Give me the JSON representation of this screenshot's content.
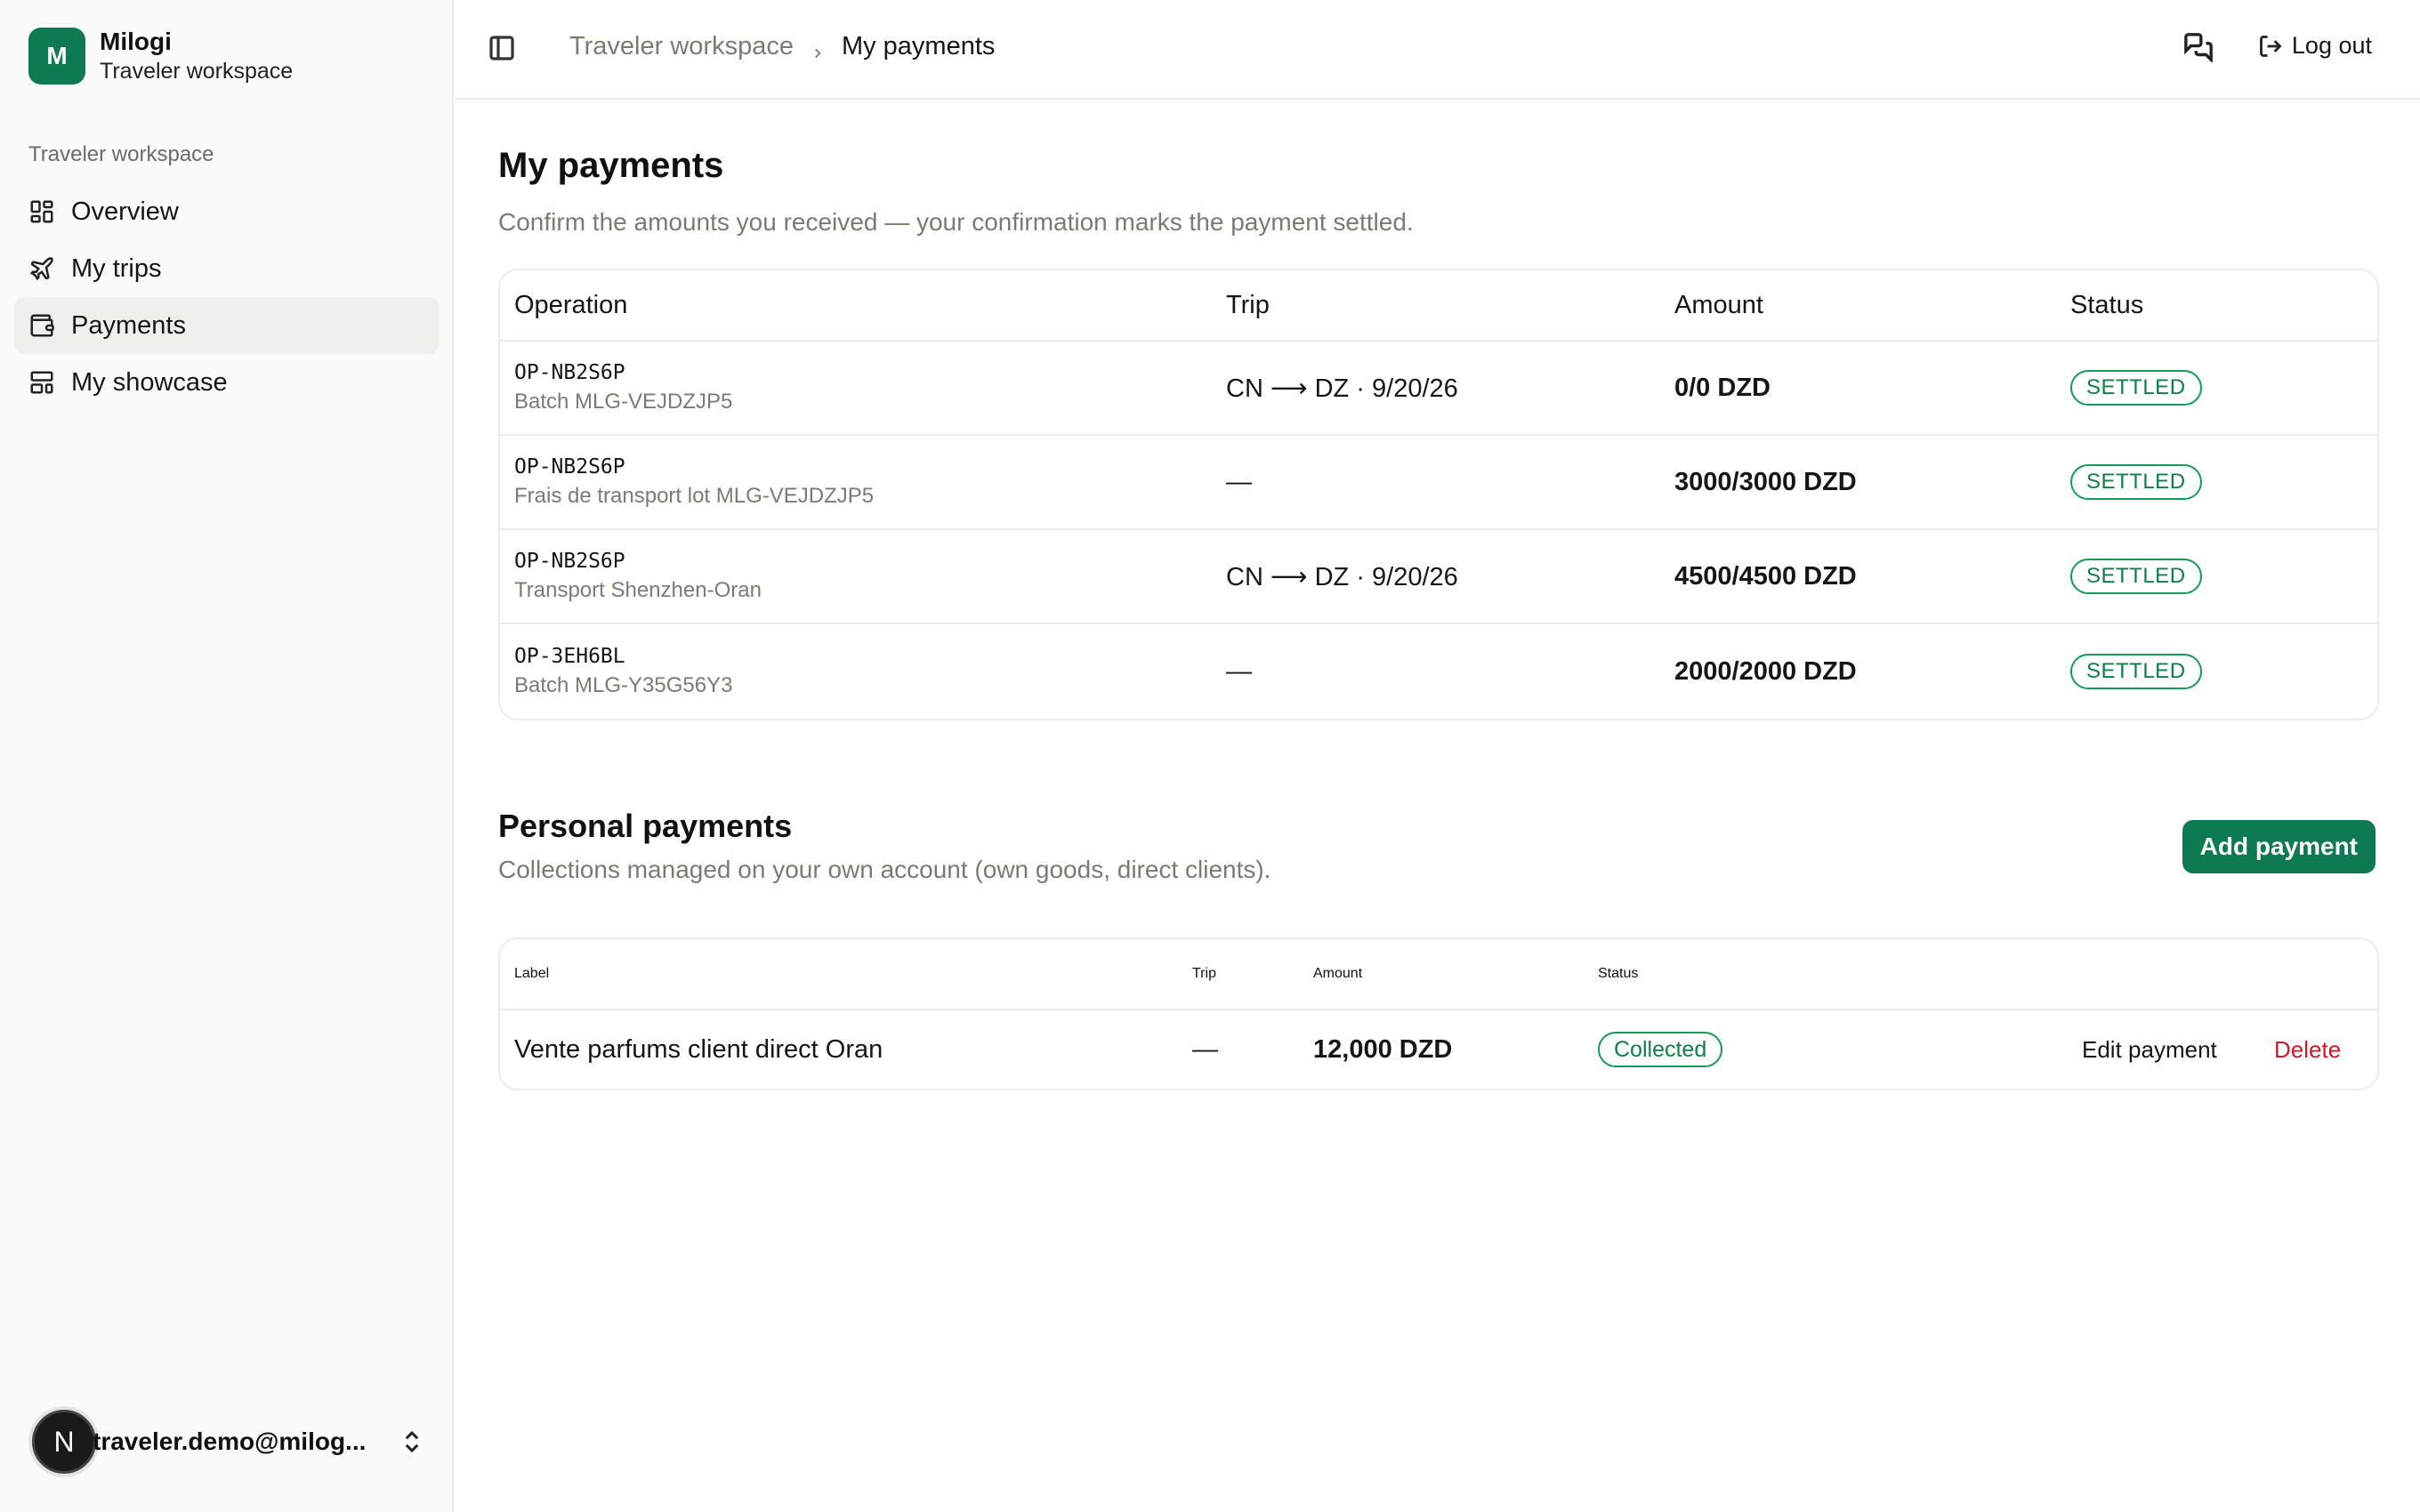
{
  "brand": {
    "initial": "M",
    "name": "Milogi",
    "workspace": "Traveler workspace"
  },
  "sidebar": {
    "section_label": "Traveler workspace",
    "items": [
      {
        "label": "Overview",
        "icon": "grid-icon",
        "active": false
      },
      {
        "label": "My trips",
        "icon": "plane-icon",
        "active": false
      },
      {
        "label": "Payments",
        "icon": "wallet-icon",
        "active": true
      },
      {
        "label": "My showcase",
        "icon": "layout-icon",
        "active": false
      }
    ],
    "user": {
      "initial": "N",
      "email": "traveler.demo@milog..."
    }
  },
  "topbar": {
    "breadcrumb": {
      "parent": "Traveler workspace",
      "current": "My payments"
    },
    "logout_label": "Log out"
  },
  "page": {
    "title": "My payments",
    "description": "Confirm the amounts you received — your confirmation marks the payment settled."
  },
  "payments_table": {
    "columns": {
      "operation": "Operation",
      "trip": "Trip",
      "amount": "Amount",
      "status": "Status"
    },
    "rows": [
      {
        "code": "OP-NB2S6P",
        "sub": "Batch MLG-VEJDZJP5",
        "trip": "CN ⟶ DZ · 9/20/26",
        "amount": "0/0 DZD",
        "status": "SETTLED"
      },
      {
        "code": "OP-NB2S6P",
        "sub": "Frais de transport lot MLG-VEJDZJP5",
        "trip": "—",
        "amount": "3000/3000 DZD",
        "status": "SETTLED"
      },
      {
        "code": "OP-NB2S6P",
        "sub": "Transport Shenzhen-Oran",
        "trip": "CN ⟶ DZ · 9/20/26",
        "amount": "4500/4500 DZD",
        "status": "SETTLED"
      },
      {
        "code": "OP-3EH6BL",
        "sub": "Batch MLG-Y35G56Y3",
        "trip": "—",
        "amount": "2000/2000 DZD",
        "status": "SETTLED"
      }
    ]
  },
  "personal": {
    "title": "Personal payments",
    "description": "Collections managed on your own account (own goods, direct clients).",
    "add_label": "Add payment",
    "columns": {
      "label": "Label",
      "trip": "Trip",
      "amount": "Amount",
      "status": "Status"
    },
    "rows": [
      {
        "label": "Vente parfums client direct Oran",
        "trip": "—",
        "amount": "12,000 DZD",
        "status": "Collected",
        "edit_label": "Edit payment",
        "delete_label": "Delete"
      }
    ]
  },
  "colors": {
    "brand": "#0d7a52",
    "status_green": "#169b5a",
    "danger": "#d11a2a",
    "muted": "#7d7a72"
  }
}
